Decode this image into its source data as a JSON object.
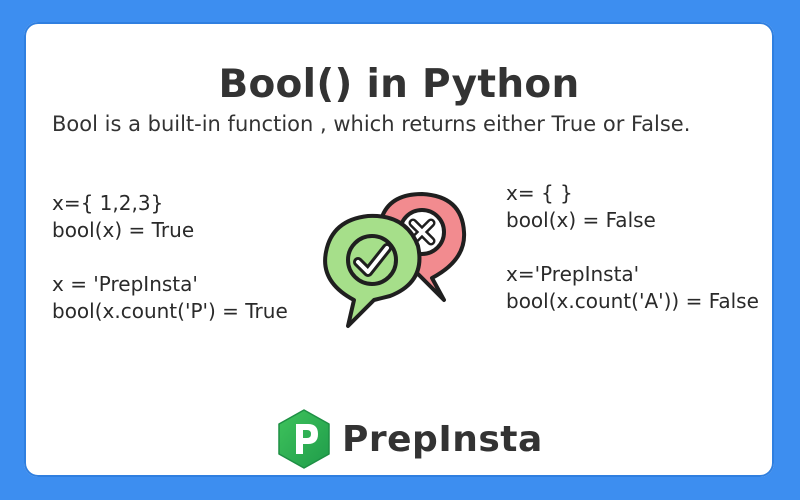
{
  "title": "Bool() in Python",
  "description": "Bool is a built-in function , which returns either True or False.",
  "left_examples": [
    "x={ 1,2,3}",
    "bool(x) = True",
    "x = 'PrepInsta'",
    "bool(x.count('P') = True"
  ],
  "right_examples": [
    "x= { }",
    "bool(x) = False",
    "x='PrepInsta'",
    "bool(x.count('A')) = False"
  ],
  "brand": {
    "name": "PrepInsta"
  },
  "colors": {
    "background": "#3d8ef0",
    "card": "#ffffff",
    "text": "#333333",
    "check_bubble": "#a6df8a",
    "cross_bubble": "#f28b8f",
    "logo_green": "#2fb45a"
  },
  "icons": {
    "check": "check-bubble-icon",
    "cross": "cross-bubble-icon",
    "logo": "prepinsta-logo-icon"
  }
}
